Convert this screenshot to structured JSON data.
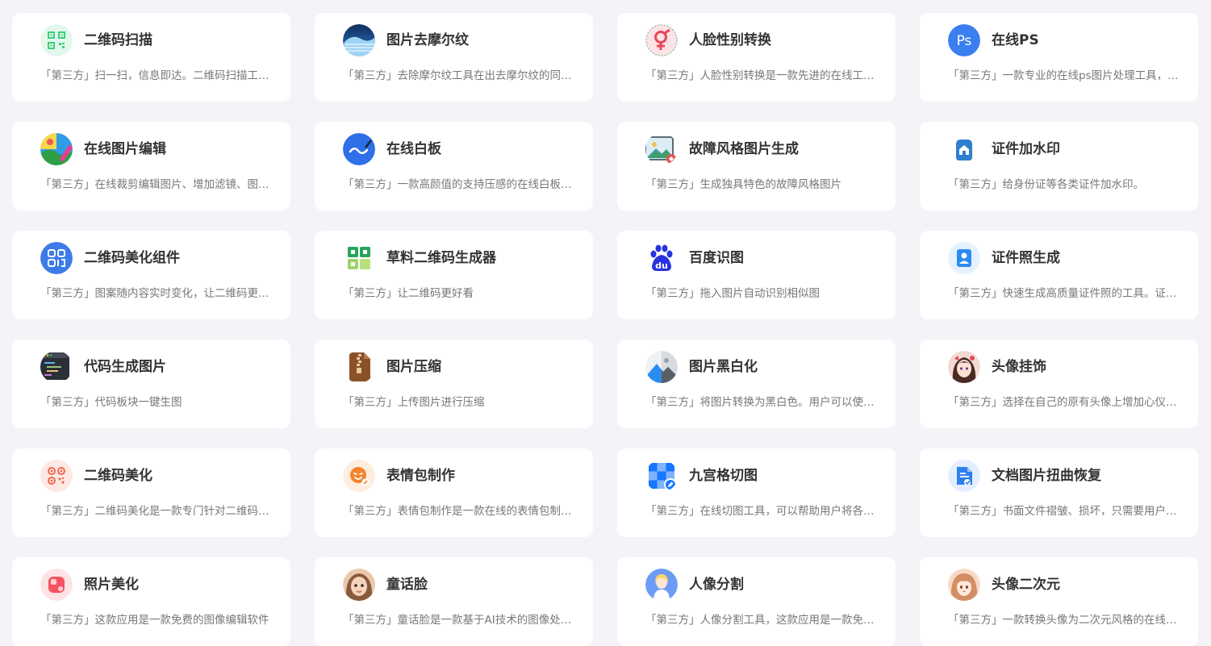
{
  "tools": [
    {
      "title": "二维码扫描",
      "desc": "「第三方」扫一扫，信息即达。二维码扫描工具，支持多种格式",
      "icon": "qrcode-scan-icon",
      "color": "#3ccf7a",
      "bg": "#e3f8ec"
    },
    {
      "title": "图片去摩尔纹",
      "desc": "「第三方」去除摩尔纹工具在出去摩尔纹的同时保留图片细节",
      "icon": "moire-wave-icon",
      "color": "#1f5fa8",
      "bg": "#1a3a6b"
    },
    {
      "title": "人脸性别转换",
      "desc": "「第三方」人脸性别转换是一款先进的在线工具，可以转换性别",
      "icon": "gender-swap-icon",
      "color": "#e8455a",
      "bg": "#fde3e6"
    },
    {
      "title": "在线PS",
      "desc": "「第三方」一款专业的在线ps图片处理工具，功能强大",
      "icon": "photoshop-icon",
      "color": "#3b7ef0",
      "bg": "#3b7ef0"
    },
    {
      "title": "在线图片编辑",
      "desc": "「第三方」在线裁剪编辑图片、增加滤镜、图片美化等功能",
      "icon": "image-edit-icon",
      "color": "#2f9e44",
      "bg": "#f7d84a"
    },
    {
      "title": "在线白板",
      "desc": "「第三方」一款高颜值的支持压感的在线白板工具，随心绘制",
      "icon": "whiteboard-icon",
      "color": "#2f6fe8",
      "bg": "#2f6fe8"
    },
    {
      "title": "故障风格图片生成",
      "desc": "「第三方」生成独具特色的故障风格图片",
      "icon": "glitch-image-icon",
      "color": "#4aa3c6",
      "bg": "#dbeef5"
    },
    {
      "title": "证件加水印",
      "desc": "「第三方」给身份证等各类证件加水印。",
      "icon": "id-watermark-icon",
      "color": "#2d7fd0",
      "bg": "#e3effa"
    },
    {
      "title": "二维码美化组件",
      "desc": "「第三方」图案随内容实时变化，让二维码更加美观好看",
      "icon": "qrcode-component-icon",
      "color": "#ffffff",
      "bg": "#3d7be8"
    },
    {
      "title": "草料二维码生成器",
      "desc": "「第三方」让二维码更好看",
      "icon": "caoliao-qrcode-icon",
      "color": "#26a65b",
      "bg": "#ffffff"
    },
    {
      "title": "百度识图",
      "desc": "「第三方」拖入图片自动识别相似图",
      "icon": "baidu-paw-icon",
      "color": "#2932e1",
      "bg": "#ffffff"
    },
    {
      "title": "证件照生成",
      "desc": "「第三方」快速生成高质量证件照的工具。证件照一键生成",
      "icon": "id-photo-icon",
      "color": "#2b8cf0",
      "bg": "#e4f1ff"
    },
    {
      "title": "代码生成图片",
      "desc": "「第三方」代码板块一键生图",
      "icon": "code-image-icon",
      "color": "#2b2f36",
      "bg": "#2b2f36"
    },
    {
      "title": "图片压缩",
      "desc": "「第三方」上传图片进行压缩",
      "icon": "zip-compress-icon",
      "color": "#8a5128",
      "bg": "#8a5128"
    },
    {
      "title": "图片黑白化",
      "desc": "「第三方」将图片转换为黑白色。用户可以使用这个工具处理",
      "icon": "grayscale-mountain-icon",
      "color": "#2b8cf0",
      "bg": "#eef2f6"
    },
    {
      "title": "头像挂饰",
      "desc": "「第三方」选择在自己的原有头像上增加心仪的挂饰",
      "icon": "avatar-pendant-icon",
      "color": "#6b3a2e",
      "bg": "#f3d9d3"
    },
    {
      "title": "二维码美化",
      "desc": "「第三方」二维码美化是一款专门针对二维码进行美化的工具",
      "icon": "qrcode-beautify-icon",
      "color": "#f0664f",
      "bg": "#fde8e3"
    },
    {
      "title": "表情包制作",
      "desc": "「第三方」表情包制作是一款在线的表情包制作工具，简单易用",
      "icon": "emoji-maker-icon",
      "color": "#f5842b",
      "bg": "#fdeede"
    },
    {
      "title": "九宫格切图",
      "desc": "「第三方」在线切图工具，可以帮助用户将各种图片切成九宫格",
      "icon": "nine-grid-icon",
      "color": "#1677ff",
      "bg": "#ffffff"
    },
    {
      "title": "文档图片扭曲恢复",
      "desc": "「第三方」书面文件褶皱、损坏，只需要用户上传图片即可恢复",
      "icon": "document-restore-icon",
      "color": "#2f80ed",
      "bg": "#e3efff"
    },
    {
      "title": "照片美化",
      "desc": "「第三方」这款应用是一款免费的图像编辑软件",
      "icon": "photo-beautify-icon",
      "color": "#f5525f",
      "bg": "#fde3e5"
    },
    {
      "title": "童话脸",
      "desc": "「第三方」童话脸是一款基于AI技术的图像处理工具",
      "icon": "fairy-face-icon",
      "color": "#8a5a3c",
      "bg": "#e9c9a9"
    },
    {
      "title": "人像分割",
      "desc": "「第三方」人像分割工具，这款应用是一款免费的在线工具",
      "icon": "portrait-segment-icon",
      "color": "#6c9cf5",
      "bg": "#a9c6fb"
    },
    {
      "title": "头像二次元",
      "desc": "「第三方」一款转换头像为二次元风格的在线工具",
      "icon": "anime-avatar-icon",
      "color": "#d48e63",
      "bg": "#f6dac6"
    }
  ]
}
